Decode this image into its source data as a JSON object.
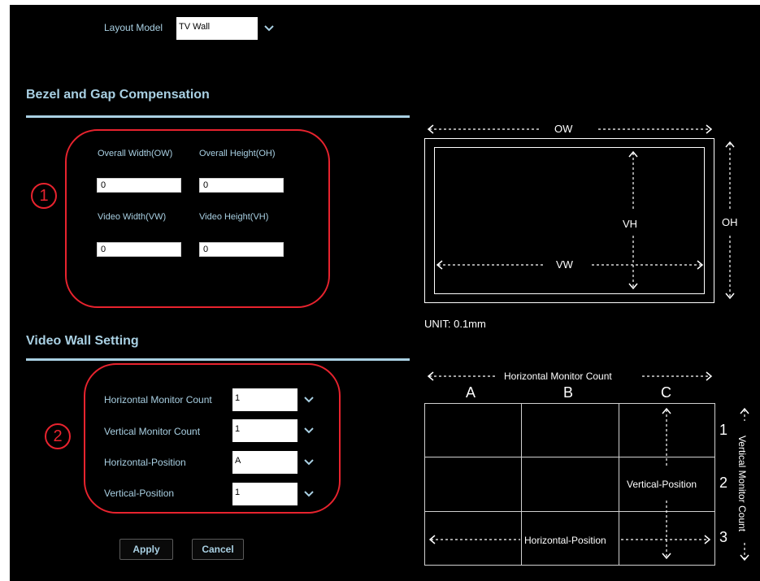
{
  "layout": {
    "label": "Layout Model",
    "value": "TV Wall"
  },
  "bezel": {
    "title": "Bezel and Gap Compensation",
    "badge": "1",
    "overall_width": {
      "label": "Overall Width(OW)",
      "value": "0"
    },
    "overall_height": {
      "label": "Overall Height(OH)",
      "value": "0"
    },
    "video_width": {
      "label": "Video Width(VW)",
      "value": "0"
    },
    "video_height": {
      "label": "Video Height(VH)",
      "value": "0"
    }
  },
  "wall": {
    "title": "Video Wall Setting",
    "badge": "2",
    "horizontal_count": {
      "label": "Horizontal Monitor Count",
      "value": "1"
    },
    "vertical_count": {
      "label": "Vertical Monitor Count",
      "value": "1"
    },
    "horizontal_position": {
      "label": "Horizontal-Position",
      "value": "A"
    },
    "vertical_position": {
      "label": "Vertical-Position",
      "value": "1"
    }
  },
  "buttons": {
    "apply": "Apply",
    "cancel": "Cancel"
  },
  "diagram1": {
    "ow": "OW",
    "oh": "OH",
    "vh": "VH",
    "vw": "VW",
    "unit": "UNIT: 0.1mm"
  },
  "diagram2": {
    "h_count": "Horizontal Monitor Count",
    "v_count": "Vertical Monitor Count",
    "cols": [
      "A",
      "B",
      "C"
    ],
    "rows": [
      "1",
      "2",
      "3"
    ],
    "v_pos": "Vertical-Position",
    "h_pos": "Horizontal-Position"
  },
  "colors": {
    "accent": "#a9d0e3",
    "highlight": "#e8232e",
    "background": "#000000"
  }
}
